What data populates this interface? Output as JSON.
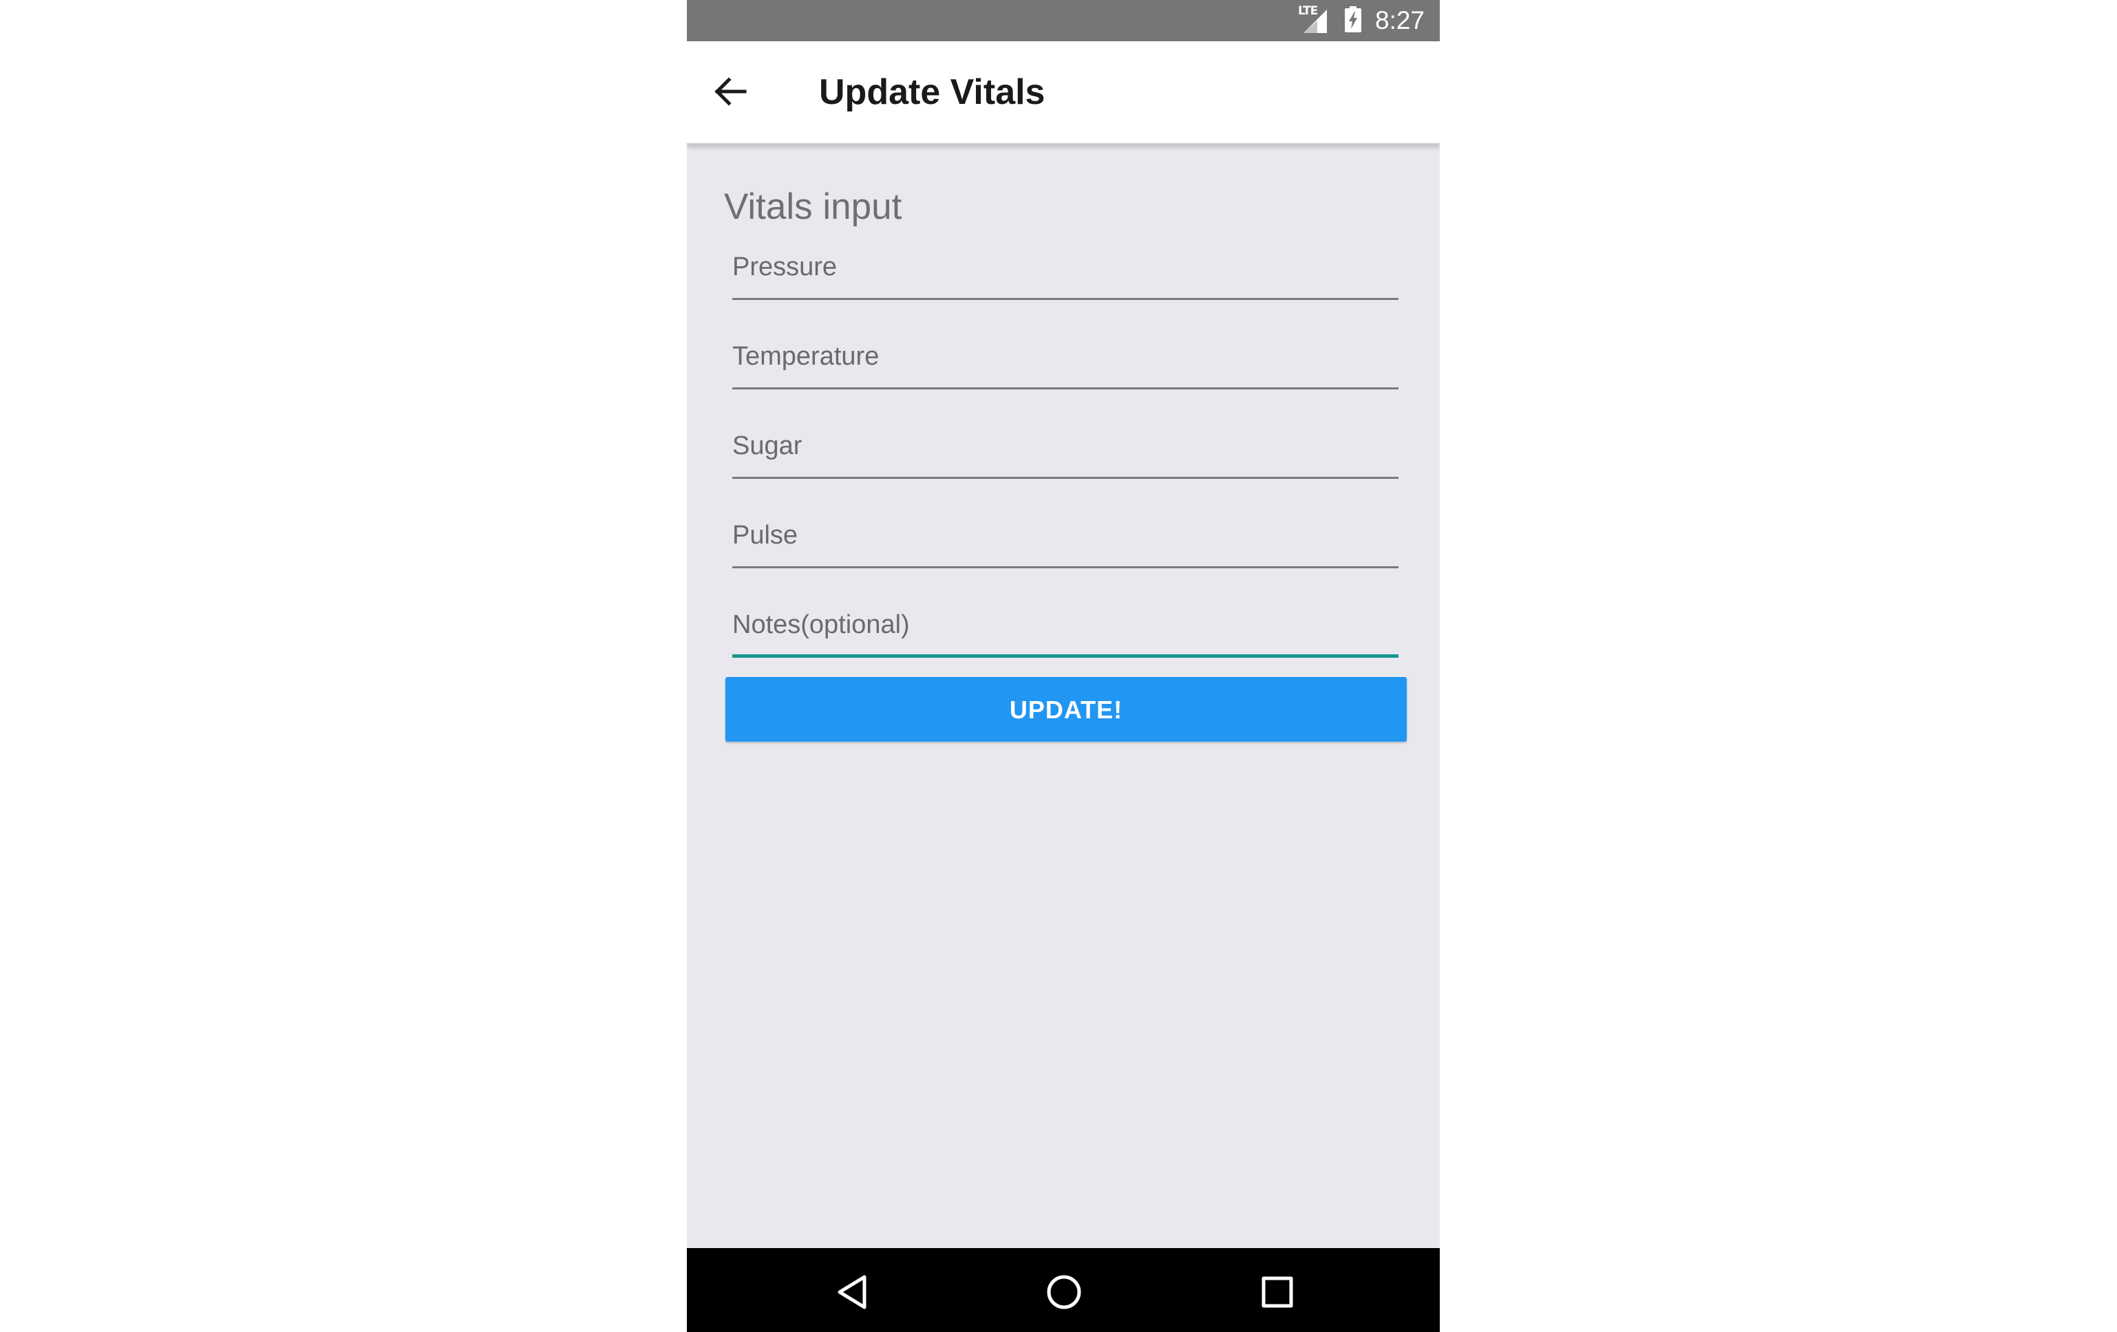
{
  "status_bar": {
    "network_label": "LTE",
    "time": "8:27",
    "icons": [
      "lte-signal-icon",
      "battery-charging-icon"
    ]
  },
  "app_bar": {
    "title": "Update Vitals",
    "back_icon": "arrow-back-icon"
  },
  "form": {
    "section_title": "Vitals input",
    "fields": [
      {
        "placeholder": "Pressure",
        "value": ""
      },
      {
        "placeholder": "Temperature",
        "value": ""
      },
      {
        "placeholder": "Sugar",
        "value": ""
      },
      {
        "placeholder": "Pulse",
        "value": ""
      },
      {
        "placeholder": "Notes(optional)",
        "value": "",
        "focused": true
      }
    ],
    "submit_label": "UPDATE!"
  },
  "nav_bar": {
    "buttons": [
      "back-triangle-icon",
      "home-circle-icon",
      "recents-square-icon"
    ]
  },
  "colors": {
    "status_bar": "#767676",
    "background": "#e9e8ee",
    "accent_button": "#2196f3",
    "focused_underline": "#16968a",
    "nav_bar": "#000000"
  }
}
